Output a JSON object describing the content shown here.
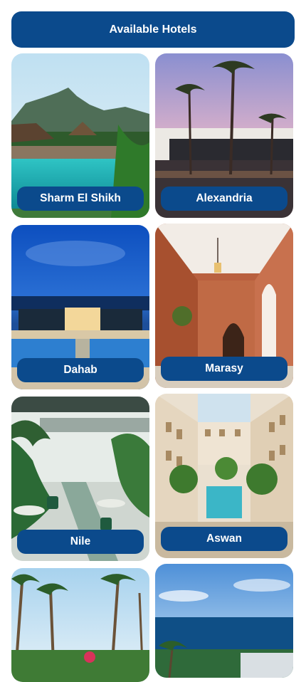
{
  "header": {
    "title": "Available Hotels"
  },
  "hotels": [
    {
      "name": "Sharm El Shikh",
      "image": "resort with pool and palm trees near mountains"
    },
    {
      "name": "Alexandria",
      "image": "palm trees at sunset by a courtyard"
    },
    {
      "name": "Dahab",
      "image": "blue night sky over hotel with pool"
    },
    {
      "name": "Marasy",
      "image": "terracotta arched corridor with plants"
    },
    {
      "name": "Nile",
      "image": "lobby with tropical plants and green chairs"
    },
    {
      "name": "Aswan",
      "image": "courtyard pool with palm trees"
    },
    {
      "name": "",
      "image": "tall coconut palms under blue sky"
    },
    {
      "name": "",
      "image": "sea view with palm trees"
    }
  ]
}
